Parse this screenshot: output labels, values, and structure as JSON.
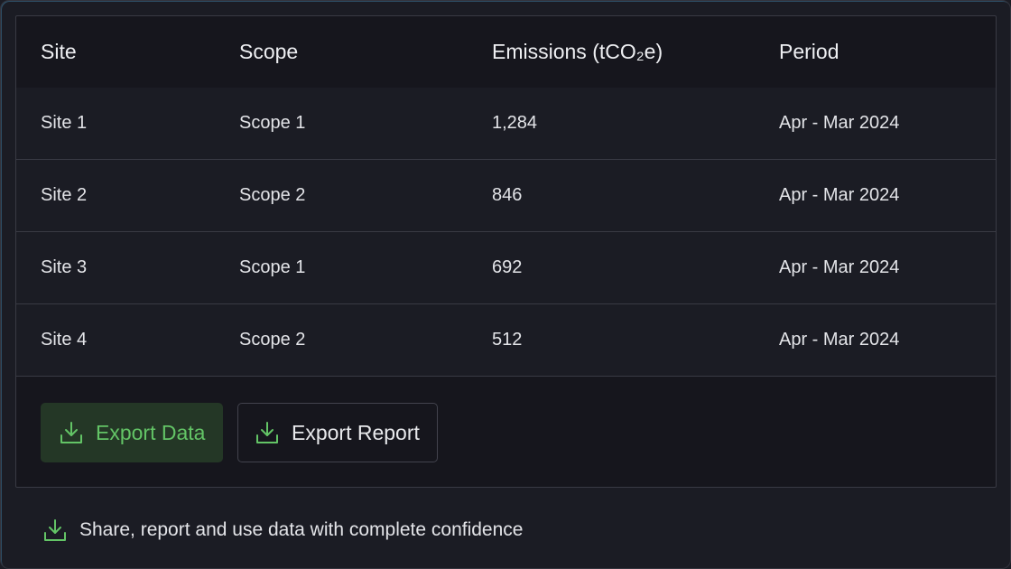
{
  "table": {
    "headers": [
      "Site",
      "Scope",
      "Emissions (tCO₂e)",
      "Period"
    ],
    "rows": [
      [
        "Site 1",
        "Scope 1",
        "1,284",
        "Apr - Mar 2024"
      ],
      [
        "Site 2",
        "Scope 2",
        "846",
        "Apr - Mar 2024"
      ],
      [
        "Site 3",
        "Scope 1",
        "692",
        "Apr - Mar 2024"
      ],
      [
        "Site 4",
        "Scope 2",
        "512",
        "Apr - Mar 2024"
      ]
    ]
  },
  "actions": {
    "export_data_label": "Export Data",
    "export_report_label": "Export Report"
  },
  "footer": {
    "text": "Share, report and use data with complete confidence"
  },
  "icons": {
    "export_data": "download-icon",
    "export_report": "download-icon",
    "footer": "download-icon"
  },
  "colors": {
    "accent_green": "#63c466",
    "button_green_bg": "#243726",
    "background": "#16161d"
  }
}
